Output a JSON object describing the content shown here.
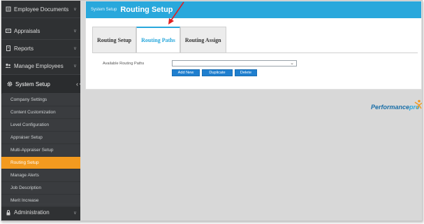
{
  "sidebar": {
    "items": [
      {
        "label": "Employee Documents",
        "icon": "document-icon"
      },
      {
        "label": "Appraisals",
        "icon": "appraisal-icon"
      },
      {
        "label": "Reports",
        "icon": "report-icon"
      },
      {
        "label": "Manage Employees",
        "icon": "people-icon"
      },
      {
        "label": "System Setup",
        "icon": "gear-icon"
      },
      {
        "label": "Administration",
        "icon": "admin-icon"
      }
    ],
    "submenu": [
      "Company Settings",
      "Content Customization",
      "Level Configuration",
      "Appraiser Setup",
      "Multi-Appraiser Setup",
      "Routing Setup",
      "Manage Alerts",
      "Job Description",
      "Merit Increase"
    ],
    "selected_submenu": "Routing Setup"
  },
  "header": {
    "breadcrumb": "System Setup",
    "title": "Routing Setup"
  },
  "tabs": [
    {
      "label": "Routing Setup"
    },
    {
      "label": "Routing Paths"
    },
    {
      "label": "Routing Assign"
    }
  ],
  "form": {
    "field_label": "Available Routing Paths",
    "select_value": ""
  },
  "buttons": {
    "add_new": "Add New",
    "duplicate": "Duplicate",
    "delete": "Delete"
  },
  "logo": {
    "text_main": "Performance",
    "text_pro": "pro"
  },
  "colors": {
    "accent": "#29a8dc",
    "selected_menu": "#f39a1f",
    "button": "#1f7fcf",
    "sidebar": "#2f3133"
  }
}
